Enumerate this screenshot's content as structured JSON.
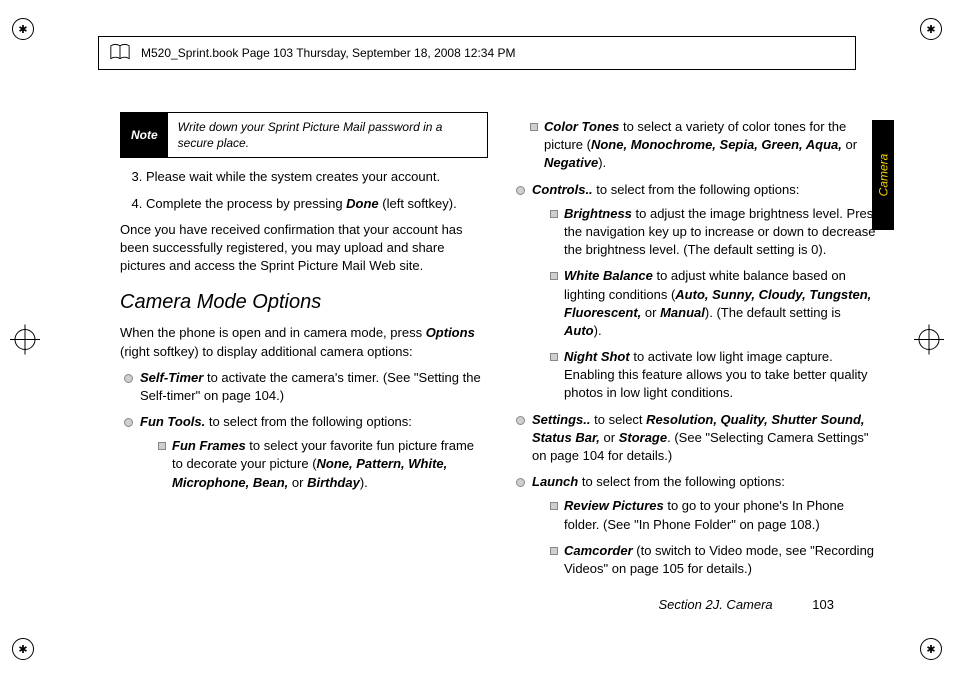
{
  "print_header": "M520_Sprint.book  Page 103  Thursday, September 18, 2008  12:34 PM",
  "side_tab": "Camera",
  "note": {
    "label": "Note",
    "text": "Write down your Sprint Picture Mail password in a secure place."
  },
  "steps": {
    "s3": "Please wait while the system creates your account.",
    "s4_a": "Complete the process by pressing ",
    "s4_b": "Done",
    "s4_c": " (left softkey)."
  },
  "body1": "Once you have received confirmation that your account has been successfully registered, you may upload and share pictures and access the Sprint Picture Mail Web site.",
  "h2": "Camera Mode Options",
  "body2_a": "When the phone is open and in camera mode, press ",
  "body2_b": "Options",
  "body2_c": " (right softkey) to display additional camera options:",
  "left_bullets": {
    "selftimer_a": "Self-Timer",
    "selftimer_b": " to activate the camera's timer. (See \"Setting the Self-timer\" on page 104.)",
    "funtools_a": "Fun Tools.",
    "funtools_b": " to select from the following options:",
    "funframes_a": "Fun Frames",
    "funframes_b": " to select your favorite fun picture frame to decorate your picture (",
    "ff_opts": "None, Pattern, White, Microphone, Bean, ",
    "ff_or": "or ",
    "ff_last": "Birthday",
    "ff_end": ")."
  },
  "right_bullets": {
    "colortones_a": "Color Tones",
    "colortones_b": " to select a variety of color tones for the picture (",
    "ct_opts": "None, Monochrome, Sepia, Green, Aqua, ",
    "ct_or": "or ",
    "ct_last": "Negative",
    "ct_end": ").",
    "controls_a": "Controls..",
    "controls_b": " to select from the following options:",
    "brightness_a": "Brightness",
    "brightness_b": " to adjust the image brightness level. Press the navigation key up to increase or down to decrease the brightness level. (The default setting is 0).",
    "wb_a": "White Balance",
    "wb_b": " to adjust white balance based on lighting conditions (",
    "wb_opts": "Auto, Sunny, Cloudy, Tungsten, Fluorescent, ",
    "wb_or": "or ",
    "wb_last": "Manual",
    "wb_c": "). (The default setting is ",
    "wb_auto": "Auto",
    "wb_end": ").",
    "ns_a": "Night Shot",
    "ns_b": " to activate low light image capture. Enabling this feature allows you to take better quality photos in low light conditions.",
    "settings_a": "Settings..",
    "settings_b": " to select ",
    "settings_opts": "Resolution, Quality, Shutter Sound, Status Bar, ",
    "settings_or": "or ",
    "settings_last": "Storage",
    "settings_c": ". (See \"Selecting Camera Settings\" on page 104 for details.)",
    "launch_a": "Launch",
    "launch_b": " to select from the following options:",
    "review_a": "Review Pictures",
    "review_b": " to go to your phone's In Phone folder. (See \"In Phone Folder\" on page 108.)",
    "cam_a": "Camcorder",
    "cam_b": " (to switch to Video mode, see \"Recording Videos\" on page 105 for details.)"
  },
  "footer": {
    "section": "Section 2J. Camera",
    "page": "103"
  }
}
